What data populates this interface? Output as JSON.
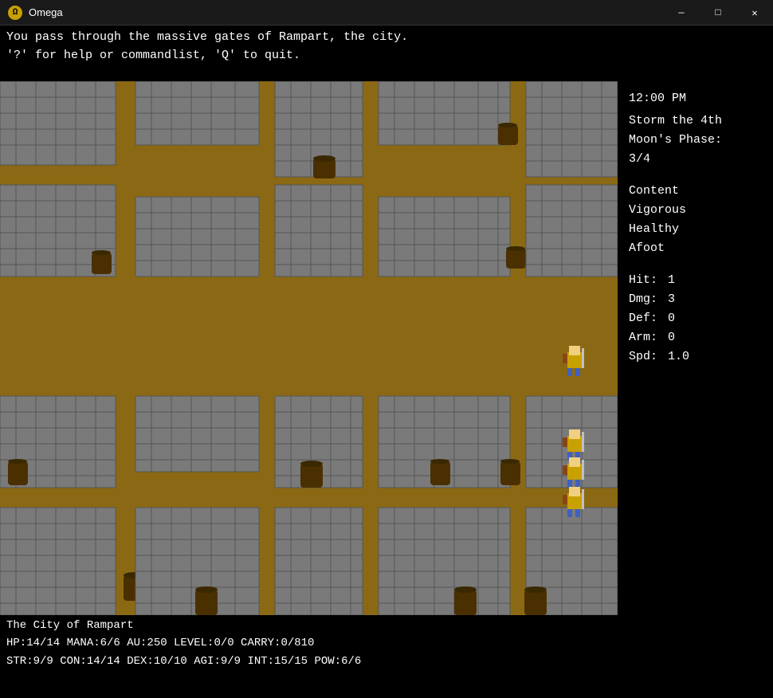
{
  "titlebar": {
    "icon": "Ω",
    "title": "Omega",
    "minimize_label": "—",
    "maximize_label": "□",
    "close_label": "✕"
  },
  "message_area": {
    "line1": "You pass through the massive gates of Rampart, the city.",
    "line2": "'?' for help or commandlist, 'Q' to quit."
  },
  "side_panel": {
    "time": "12:00 PM",
    "date": "Storm the 4th",
    "moon_label": "Moon's Phase:",
    "moon_value": "3/4",
    "status1": "Content",
    "status2": "Vigorous",
    "status3": "Healthy",
    "status4": "Afoot",
    "hit_label": "Hit:",
    "hit_value": "1",
    "dmg_label": "Dmg:",
    "dmg_value": "3",
    "def_label": "Def:",
    "def_value": "0",
    "arm_label": "Arm:",
    "arm_value": "0",
    "spd_label": "Spd:",
    "spd_value": "1.0"
  },
  "status_bar": {
    "location": "The City of Rampart",
    "stats1": "HP:14/14  MANA:6/6  AU:250  LEVEL:0/0  CARRY:0/810",
    "stats2": "STR:9/9  CON:14/14  DEX:10/10  AGI:9/9  INT:15/15  POW:6/6"
  }
}
